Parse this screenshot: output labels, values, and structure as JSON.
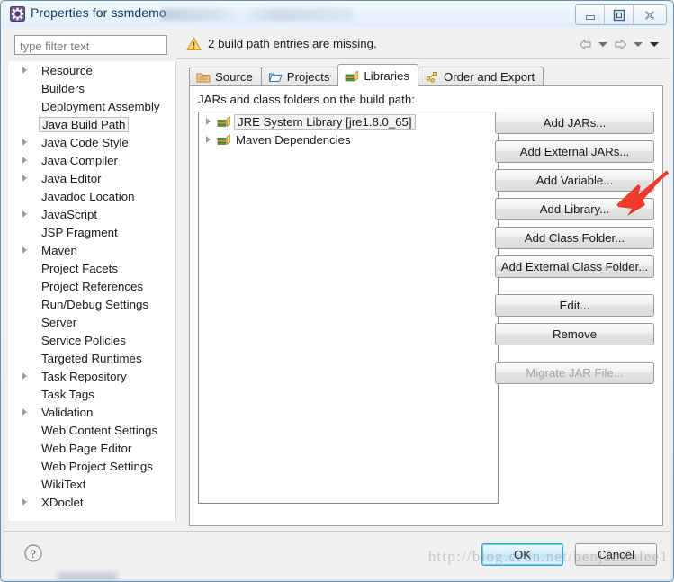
{
  "window": {
    "title": "Properties for ssmdemo",
    "icon": "properties-gear-icon",
    "controls": {
      "minimize": "minimize-icon",
      "maximize": "maximize-icon",
      "close": "close-icon"
    }
  },
  "filter": {
    "placeholder": "type filter text",
    "value": ""
  },
  "sidebar": {
    "items": [
      {
        "label": "Resource",
        "expandable": true,
        "selected": false
      },
      {
        "label": "Builders",
        "expandable": false,
        "selected": false
      },
      {
        "label": "Deployment Assembly",
        "expandable": false,
        "selected": false
      },
      {
        "label": "Java Build Path",
        "expandable": false,
        "selected": true
      },
      {
        "label": "Java Code Style",
        "expandable": true,
        "selected": false
      },
      {
        "label": "Java Compiler",
        "expandable": true,
        "selected": false
      },
      {
        "label": "Java Editor",
        "expandable": true,
        "selected": false
      },
      {
        "label": "Javadoc Location",
        "expandable": false,
        "selected": false
      },
      {
        "label": "JavaScript",
        "expandable": true,
        "selected": false
      },
      {
        "label": "JSP Fragment",
        "expandable": false,
        "selected": false
      },
      {
        "label": "Maven",
        "expandable": true,
        "selected": false
      },
      {
        "label": "Project Facets",
        "expandable": false,
        "selected": false
      },
      {
        "label": "Project References",
        "expandable": false,
        "selected": false
      },
      {
        "label": "Run/Debug Settings",
        "expandable": false,
        "selected": false
      },
      {
        "label": "Server",
        "expandable": false,
        "selected": false
      },
      {
        "label": "Service Policies",
        "expandable": false,
        "selected": false
      },
      {
        "label": "Targeted Runtimes",
        "expandable": false,
        "selected": false
      },
      {
        "label": "Task Repository",
        "expandable": true,
        "selected": false
      },
      {
        "label": "Task Tags",
        "expandable": false,
        "selected": false
      },
      {
        "label": "Validation",
        "expandable": true,
        "selected": false
      },
      {
        "label": "Web Content Settings",
        "expandable": false,
        "selected": false
      },
      {
        "label": "Web Page Editor",
        "expandable": false,
        "selected": false
      },
      {
        "label": "Web Project Settings",
        "expandable": false,
        "selected": false
      },
      {
        "label": "WikiText",
        "expandable": false,
        "selected": false
      },
      {
        "label": "XDoclet",
        "expandable": true,
        "selected": false
      }
    ]
  },
  "message": {
    "icon": "warning-icon",
    "text": "2 build path entries are missing.",
    "nav": {
      "back": "back-arrow-icon",
      "back_menu": "back-dropdown-icon",
      "forward": "forward-arrow-icon",
      "forward_menu": "forward-dropdown-icon",
      "history_menu": "history-dropdown-icon"
    }
  },
  "tabs": [
    {
      "label": "Source",
      "icon": "source-folder-icon",
      "active": false
    },
    {
      "label": "Projects",
      "icon": "project-folder-icon",
      "active": false
    },
    {
      "label": "Libraries",
      "icon": "books-icon",
      "active": true
    },
    {
      "label": "Order and Export",
      "icon": "order-export-icon",
      "active": false
    }
  ],
  "libraries_panel": {
    "caption": "JARs and class folders on the build path:",
    "entries": [
      {
        "label": "JRE System Library [jre1.8.0_65]",
        "icon": "library-icon",
        "expandable": true,
        "selected": true
      },
      {
        "label": "Maven Dependencies",
        "icon": "library-icon",
        "expandable": true,
        "selected": false
      }
    ],
    "buttons": [
      {
        "label": "Add JARs...",
        "enabled": true,
        "group": 0
      },
      {
        "label": "Add External JARs...",
        "enabled": true,
        "group": 0
      },
      {
        "label": "Add Variable...",
        "enabled": true,
        "group": 0
      },
      {
        "label": "Add Library...",
        "enabled": true,
        "group": 0,
        "highlighted": true
      },
      {
        "label": "Add Class Folder...",
        "enabled": true,
        "group": 0
      },
      {
        "label": "Add External Class Folder...",
        "enabled": true,
        "group": 0
      },
      {
        "label": "Edit...",
        "enabled": true,
        "group": 1
      },
      {
        "label": "Remove",
        "enabled": true,
        "group": 1
      },
      {
        "label": "Migrate JAR File...",
        "enabled": false,
        "group": 2
      }
    ]
  },
  "footer": {
    "help": "help-icon",
    "ok_label": "OK",
    "cancel_label": "Cancel"
  },
  "watermark": {
    "text": "http://blog.csdn.net/benjaminlee1"
  },
  "annotation": {
    "arrow": "red-pointer-arrow",
    "color": "#ee3b2c",
    "target": "Add Library..."
  },
  "colors": {
    "accent": "#3c9cd4",
    "warning": "#f0b428",
    "window_border": "#6d8faf",
    "panel_bg": "#f0f0f0"
  }
}
